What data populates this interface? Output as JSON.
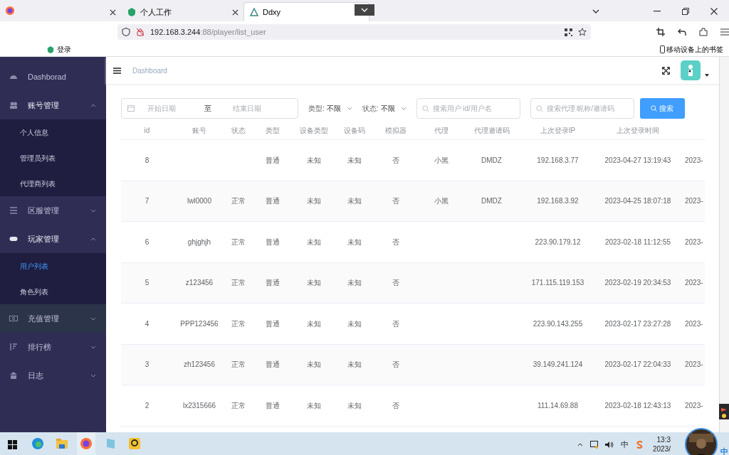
{
  "browser": {
    "tabs": [
      {
        "selected": false
      },
      {
        "label": "个人工作",
        "selected": false
      },
      {
        "label": "Ddxy",
        "selected": true
      }
    ],
    "url_host": "192.168.3.244",
    "url_path": ":88/player/list_user",
    "bookmarks": [
      {
        "label": "登录"
      }
    ],
    "mobile_bookmarks": "移动设备上的书签"
  },
  "sidebar": {
    "items": [
      {
        "label": "Dashborad",
        "highlighted": false
      },
      {
        "label": "账号管理",
        "expanded": true,
        "highlighted": false,
        "children": [
          {
            "label": "个人信息",
            "selected": false
          },
          {
            "label": "管理员列表",
            "selected": false
          },
          {
            "label": "代理商列表",
            "selected": false
          }
        ]
      },
      {
        "label": "区服管理",
        "expanded": false,
        "highlighted": false
      },
      {
        "label": "玩家管理",
        "expanded": true,
        "highlighted": false,
        "children": [
          {
            "label": "用户列表",
            "selected": true
          },
          {
            "label": "角色列表",
            "selected": false
          }
        ]
      },
      {
        "label": "充值管理",
        "expanded": false,
        "highlighted": true
      },
      {
        "label": "排行榜",
        "expanded": false,
        "highlighted": false
      },
      {
        "label": "日志",
        "expanded": false,
        "highlighted": false
      }
    ]
  },
  "header": {
    "breadcrumb": "Dashboard"
  },
  "filters": {
    "start_placeholder": "开始日期",
    "range_separator": "至",
    "end_placeholder": "结束日期",
    "type_label": "类型:",
    "type_value": "不限",
    "status_label": "状态:",
    "status_value": "不限",
    "user_search_placeholder": "搜索用户 id/用户名",
    "agent_search_placeholder": "搜索代理 昵称/邀请码",
    "search_button": "搜索"
  },
  "table": {
    "columns": [
      "id",
      "账号",
      "状态",
      "类型",
      "设备类型",
      "设备码",
      "模拟器",
      "代理",
      "代理邀请码",
      "上次登录IP",
      "上次登录时间"
    ],
    "rows": [
      {
        "cells": [
          "8",
          "",
          "",
          "普通",
          "未知",
          "未知",
          "否",
          "小黑",
          "DMDZ",
          "192.168.3.77",
          "2023-04-27 13:19:43",
          "2023-"
        ]
      },
      {
        "cells": [
          "7",
          "lwl0000",
          "正常",
          "普通",
          "未知",
          "未知",
          "否",
          "小黑",
          "DMDZ",
          "192.168.3.92",
          "2023-04-25 18:07:18",
          "2023-"
        ]
      },
      {
        "cells": [
          "6",
          "ghjghjh",
          "正常",
          "普通",
          "未知",
          "未知",
          "否",
          "",
          "",
          "223.90.179.12",
          "2023-02-18 11:12:55",
          "2023-"
        ]
      },
      {
        "cells": [
          "5",
          "z123456",
          "正常",
          "普通",
          "未知",
          "未知",
          "否",
          "",
          "",
          "171.115.119.153",
          "2023-02-19 20:34:53",
          "2023-"
        ]
      },
      {
        "cells": [
          "4",
          "PPP123456",
          "正常",
          "普通",
          "未知",
          "未知",
          "否",
          "",
          "",
          "223.90.143.255",
          "2023-02-17 23:27:28",
          "2023-"
        ]
      },
      {
        "cells": [
          "3",
          "zh123456",
          "正常",
          "普通",
          "未知",
          "未知",
          "否",
          "",
          "",
          "39.149.241.124",
          "2023-02-17 22:04:33",
          "2023-"
        ]
      },
      {
        "cells": [
          "2",
          "lx2315666",
          "正常",
          "普通",
          "未知",
          "未知",
          "否",
          "",
          "",
          "111.14.69.88",
          "2023-02-18 12:43:13",
          "2023-"
        ]
      }
    ]
  },
  "taskbar": {
    "apps": [
      {
        "selected": false
      },
      {
        "selected": false
      },
      {
        "selected": true
      },
      {
        "selected": false
      },
      {
        "selected": false
      }
    ],
    "ime": "中",
    "time": "13:3",
    "date": "2023/",
    "corner_ime": "中"
  }
}
